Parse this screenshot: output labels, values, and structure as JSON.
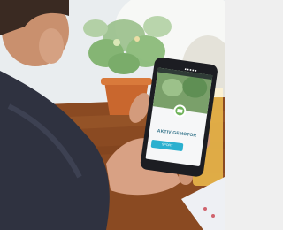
{
  "scene": {
    "description_label": "Photo of a person holding a smartphone showing a garden app",
    "colors": {
      "background_wall": "#eef1f3",
      "table_wood": "#8a4a22",
      "pot": "#c9672e",
      "plant": "#6da95a",
      "jacket": "#2f3240",
      "skin": "#d8a184",
      "phone_body": "#1c1d22",
      "screen_white": "#f6f7f8",
      "app_accent": "#2bb0cf",
      "app_title_color": "#2e6f86"
    }
  },
  "phone_screen": {
    "status_text": "■■■■■",
    "title": "AKTIV GEMOTOR",
    "button_label": "SPORT"
  }
}
